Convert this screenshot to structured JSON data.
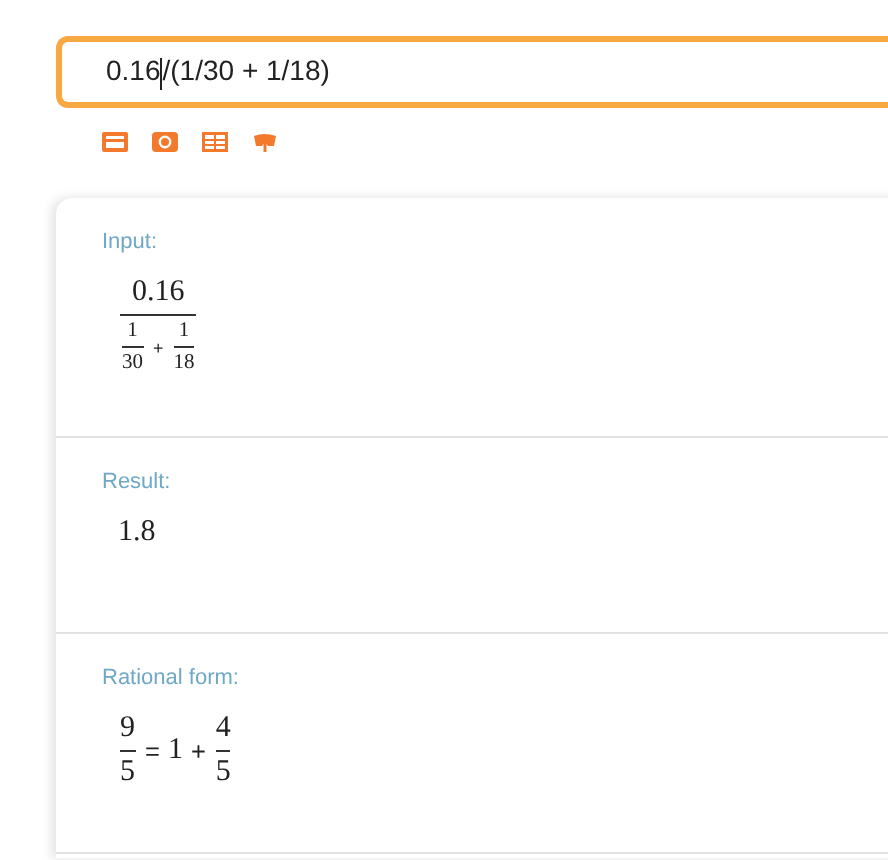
{
  "query": {
    "text_before_caret": "0.16",
    "text_after_caret": "/(1/30 + 1/18)"
  },
  "pods": [
    {
      "title": "Input:",
      "math": [
        {
          "kind": "frac",
          "num": [
            {
              "kind": "num",
              "text": "0.16"
            }
          ],
          "den": [
            {
              "kind": "frac",
              "num": [
                {
                  "kind": "num",
                  "text": "1"
                }
              ],
              "den": [
                {
                  "kind": "num",
                  "text": "30"
                }
              ]
            },
            {
              "kind": "op",
              "text": "+"
            },
            {
              "kind": "frac",
              "num": [
                {
                  "kind": "num",
                  "text": "1"
                }
              ],
              "den": [
                {
                  "kind": "num",
                  "text": "18"
                }
              ]
            }
          ]
        }
      ]
    },
    {
      "title": "Result:",
      "math": [
        {
          "kind": "num",
          "text": "1.8"
        }
      ]
    },
    {
      "title": "Rational form:",
      "math": [
        {
          "kind": "frac",
          "num": [
            {
              "kind": "num",
              "text": "9"
            }
          ],
          "den": [
            {
              "kind": "num",
              "text": "5"
            }
          ]
        },
        {
          "kind": "op",
          "text": "="
        },
        {
          "kind": "num",
          "text": "1"
        },
        {
          "kind": "op",
          "text": "+"
        },
        {
          "kind": "frac",
          "num": [
            {
              "kind": "num",
              "text": "4"
            }
          ],
          "den": [
            {
              "kind": "num",
              "text": "5"
            }
          ]
        }
      ]
    }
  ]
}
